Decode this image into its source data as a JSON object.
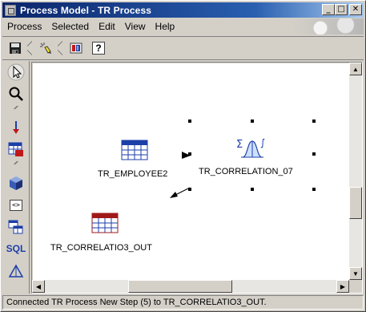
{
  "window": {
    "title": "Process Model - TR Process",
    "controls": [
      "_",
      "□",
      "✕"
    ]
  },
  "menu": {
    "items": [
      "Process",
      "Selected",
      "Edit",
      "View",
      "Help"
    ]
  },
  "toolbar": {
    "items": [
      {
        "icon": "save-icon"
      },
      {
        "icon": "highlighter-icon"
      },
      {
        "icon": "report-icon"
      },
      {
        "icon": "help-icon",
        "glyph": "?"
      }
    ]
  },
  "palette": {
    "items": [
      {
        "icon": "pointer-icon"
      },
      {
        "icon": "zoom-icon"
      },
      {
        "icon": "connector-icon"
      },
      {
        "icon": "table-source-icon"
      },
      {
        "icon": "cube-icon"
      },
      {
        "icon": "program-icon",
        "glyph": "<>"
      },
      {
        "icon": "tables-icon"
      },
      {
        "icon": "sql-icon",
        "glyph": "SQL"
      },
      {
        "icon": "triangle-icon"
      }
    ]
  },
  "canvas": {
    "nodes": [
      {
        "name": "TR_EMPLOYEE2",
        "icon": "table-blue-icon"
      },
      {
        "name": "TR_CORRELATION_07",
        "icon": "correlation-icon",
        "selected": true
      },
      {
        "name": "TR_CORRELATIO3_OUT",
        "icon": "table-red-icon"
      }
    ]
  },
  "status": {
    "text": "Connected TR Process New Step (5) to TR_CORRELATIO3_OUT."
  },
  "colors": {
    "titlebar_start": "#0a246a",
    "titlebar_end": "#a6caf0",
    "window_bg": "#d4d0c8",
    "table_blue": "#1c3fa8",
    "table_red": "#a01818"
  }
}
